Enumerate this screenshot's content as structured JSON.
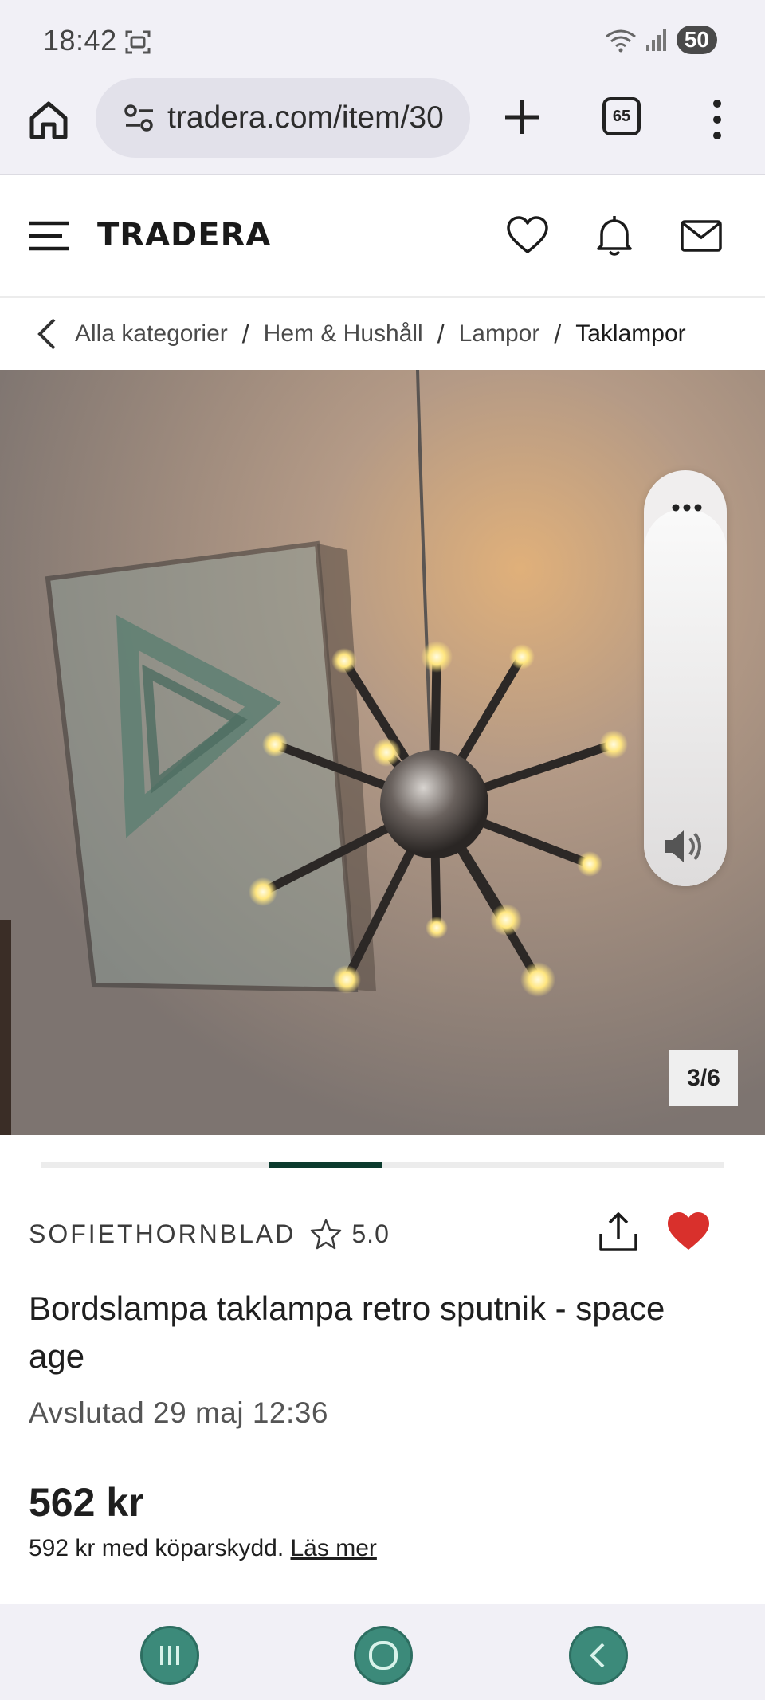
{
  "status_bar": {
    "time": "18:42",
    "battery": "50",
    "icons": [
      "screenshot-icon",
      "wifi-icon",
      "signal-icon"
    ]
  },
  "browser": {
    "url": "tradera.com/item/30",
    "tab_count": "65",
    "icons": [
      "home-icon",
      "site-settings-icon",
      "plus-icon",
      "more-vertical-icon"
    ]
  },
  "header": {
    "logo": "TRADERA",
    "icons": [
      "menu-icon",
      "heart-icon",
      "bell-icon",
      "mail-icon"
    ]
  },
  "breadcrumb": {
    "items": [
      "Alla kategorier",
      "Hem & Hushåll",
      "Lampor"
    ],
    "current": "Taklampor",
    "separator": "/"
  },
  "gallery": {
    "counter": "3/6",
    "current_index": 3,
    "total": 6
  },
  "seller": {
    "name": "SOFIETHORNBLAD",
    "rating": "5.0"
  },
  "listing": {
    "title": "Bordslampa taklampa retro sputnik - space age",
    "status": "Avslutad 29 maj 12:36",
    "price": "562 kr",
    "buyer_protection": "592 kr med köparskydd.",
    "read_more": "Läs mer"
  },
  "colors": {
    "accent": "#0c3b2e",
    "favorite": "#d9302c",
    "nav_button": "#3c8a7a"
  }
}
